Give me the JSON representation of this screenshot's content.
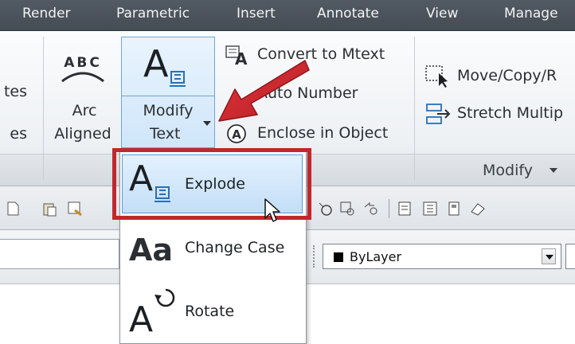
{
  "tabs": [
    "Render",
    "Parametric",
    "Insert",
    "Annotate",
    "View",
    "Manage"
  ],
  "ribbon": {
    "left_clip_top": "tes",
    "left_clip_bottom": "es",
    "arc_aligned": {
      "icon": "ABC",
      "line1": "Arc",
      "line2": "Aligned"
    },
    "modify_text": {
      "line1": "Modify",
      "line2": "Text"
    },
    "convert_to_mtext": "Convert to Mtext",
    "auto_number": "Auto Number",
    "enclose_in_object": "Enclose in Object",
    "move_copy_rotate": "Move/Copy/R",
    "stretch_multiple": "Stretch Multip",
    "modify_panel_label": "Modify"
  },
  "dropdown": {
    "items": [
      {
        "label": "Explode",
        "icon": "explode-text-icon"
      },
      {
        "label": "Change Case",
        "icon": "change-case-icon"
      },
      {
        "label": "Rotate",
        "icon": "rotate-text-icon"
      }
    ]
  },
  "properties": {
    "color_value": "ByLayer"
  },
  "colors": {
    "tabbar": "#4b525a",
    "highlight_border": "#6fa7d8",
    "callout_red": "#c1272d"
  }
}
